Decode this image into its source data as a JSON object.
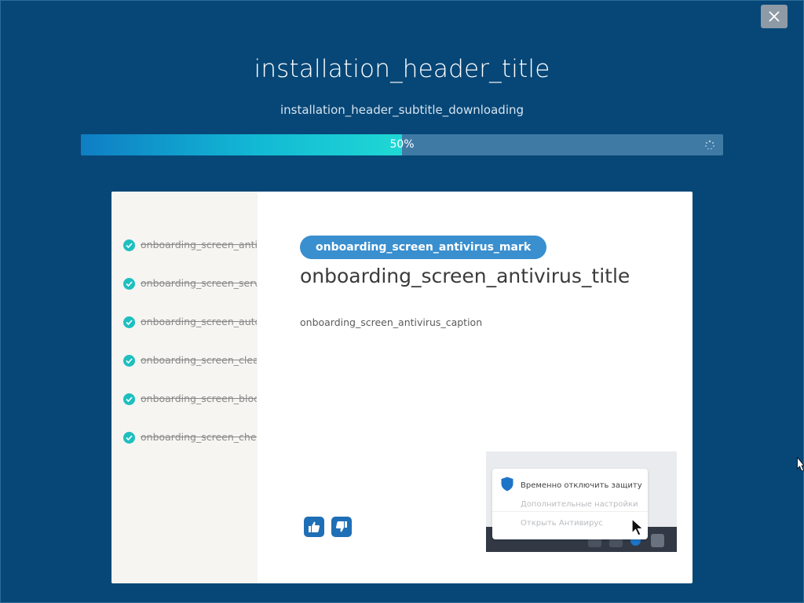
{
  "header": {
    "title": "installation_header_title",
    "subtitle": "installation_header_subtitle_downloading"
  },
  "progress": {
    "value": 0.5,
    "label": "50%"
  },
  "steps": [
    {
      "label": "onboarding_screen_antiv",
      "done": true
    },
    {
      "label": "onboarding_screen_serv",
      "done": true
    },
    {
      "label": "onboarding_screen_auto",
      "done": true
    },
    {
      "label": "onboarding_screen_clea",
      "done": true
    },
    {
      "label": "onboarding_screen_bloc",
      "done": true
    },
    {
      "label": "onboarding_screen_chec",
      "done": true
    }
  ],
  "card": {
    "mark": "onboarding_screen_antivirus_mark",
    "title": "onboarding_screen_antivirus_title",
    "caption": "onboarding_screen_antivirus_caption"
  },
  "preview_menu": {
    "items": [
      "Временно отключить защиту",
      "Дополнительные настройки",
      "Открыть Антивирус"
    ]
  },
  "icons": {
    "close": "close-icon",
    "like": "thumbs-up-icon",
    "dislike": "thumbs-down-icon",
    "check": "check-circle-icon",
    "shield": "shield-icon",
    "spinner": "spinner-icon"
  },
  "colors": {
    "background": "#074777",
    "accent": "#3a8fcf",
    "progress_fill": "#1fd8d4",
    "check": "#1fbfc0"
  }
}
